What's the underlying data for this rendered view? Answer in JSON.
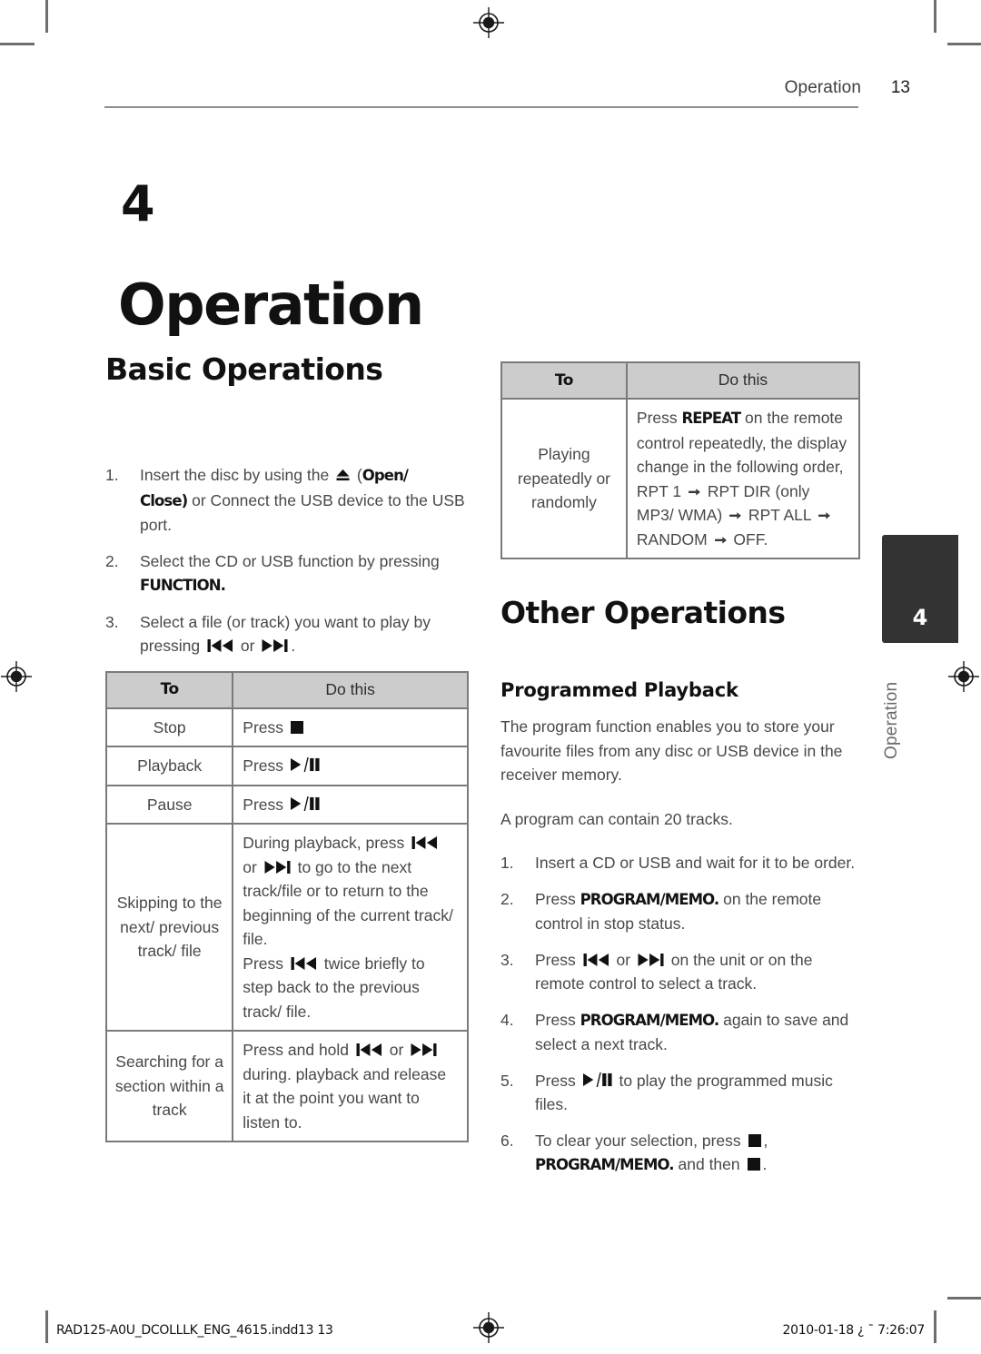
{
  "header": {
    "section_title": "Operation",
    "page_number": "13"
  },
  "chapter": {
    "number": "4",
    "title": "Operation"
  },
  "thumb_tab": {
    "number": "4",
    "label": "Operation"
  },
  "left_column": {
    "section_heading": "Basic Operations",
    "steps": [
      {
        "num": "1.",
        "parts": [
          {
            "t": "Insert the disc by using the "
          },
          {
            "icon": "eject-icon"
          },
          {
            "t": " ("
          },
          {
            "b": "Open/"
          },
          {
            "br": true
          },
          {
            "b": "Close)"
          },
          {
            "t": " or Connect the USB device to the USB port."
          }
        ]
      },
      {
        "num": "2.",
        "parts": [
          {
            "t": "Select the CD or USB function by pressing "
          },
          {
            "b": "FUNCTION."
          }
        ]
      },
      {
        "num": "3.",
        "parts": [
          {
            "t": "Select a file (or track) you want to play by pressing "
          },
          {
            "icon": "skip-previous-icon"
          },
          {
            "t": " or "
          },
          {
            "icon": "skip-next-icon"
          },
          {
            "t": "."
          }
        ]
      }
    ],
    "table": {
      "headers": [
        "To",
        "Do this"
      ],
      "rows": [
        {
          "to": "Stop",
          "do_parts": [
            {
              "t": "Press "
            },
            {
              "icon": "stop-icon"
            }
          ]
        },
        {
          "to": "Playback",
          "do_parts": [
            {
              "t": "Press "
            },
            {
              "icon": "play-pause-icon"
            }
          ]
        },
        {
          "to": "Pause",
          "do_parts": [
            {
              "t": "Press "
            },
            {
              "icon": "play-pause-icon"
            }
          ]
        },
        {
          "to": "Skipping to the next/ previous track/ file",
          "do_parts": [
            {
              "t": "During playback, press "
            },
            {
              "icon": "skip-previous-icon"
            },
            {
              "t": " or "
            },
            {
              "icon": "skip-next-icon"
            },
            {
              "t": " to go to the next track/file or to return to the beginning of the current track/ file."
            },
            {
              "br": true
            },
            {
              "t": "Press "
            },
            {
              "icon": "skip-previous-icon"
            },
            {
              "t": " twice briefly to step back to the previous track/ file."
            }
          ]
        },
        {
          "to": "Searching for a section within a track",
          "do_parts": [
            {
              "t": "Press and hold "
            },
            {
              "icon": "skip-previous-icon"
            },
            {
              "t": " or "
            },
            {
              "icon": "skip-next-icon"
            },
            {
              "t": " during. playback and release it at the point you want to listen to."
            }
          ]
        }
      ]
    }
  },
  "right_column": {
    "table": {
      "headers": [
        "To",
        "Do this"
      ],
      "rows": [
        {
          "to": "Playing repeatedly or randomly",
          "do_parts": [
            {
              "t": "Press "
            },
            {
              "b": "REPEAT"
            },
            {
              "t": " on the remote control repeatedly, the display change in the following order, RPT 1 "
            },
            {
              "icon": "arrow-right-icon"
            },
            {
              "t": " RPT DIR (only MP3/ WMA) "
            },
            {
              "icon": "arrow-right-icon"
            },
            {
              "t": " RPT ALL "
            },
            {
              "icon": "arrow-right-icon"
            },
            {
              "t": " RANDOM "
            },
            {
              "icon": "arrow-right-icon"
            },
            {
              "t": " OFF."
            }
          ]
        }
      ]
    },
    "section_heading": "Other Operations",
    "subsection_heading": "Programmed Playback",
    "intro_paragraph_1": "The program function enables you to store your favourite files from any disc or USB device in the receiver memory.",
    "intro_paragraph_2": "A program can contain 20 tracks.",
    "steps": [
      {
        "num": "1.",
        "parts": [
          {
            "t": "Insert a CD or USB and wait for it to be order."
          }
        ]
      },
      {
        "num": "2.",
        "parts": [
          {
            "t": "Press "
          },
          {
            "b": "PROGRAM/MEMO."
          },
          {
            "t": " on the remote control in stop status."
          }
        ]
      },
      {
        "num": "3.",
        "parts": [
          {
            "t": "Press "
          },
          {
            "icon": "skip-previous-icon"
          },
          {
            "t": " or "
          },
          {
            "icon": "skip-next-icon"
          },
          {
            "t": " on the unit or on the remote control to select a track."
          }
        ]
      },
      {
        "num": "4.",
        "parts": [
          {
            "t": "Press "
          },
          {
            "b": "PROGRAM/MEMO."
          },
          {
            "t": " again to save and select a next track."
          }
        ]
      },
      {
        "num": "5.",
        "parts": [
          {
            "t": "Press "
          },
          {
            "icon": "play-pause-icon"
          },
          {
            "t": " to play the programmed music files."
          }
        ]
      },
      {
        "num": "6.",
        "parts": [
          {
            "t": "To clear your selection, press "
          },
          {
            "icon": "stop-icon"
          },
          {
            "t": ", "
          },
          {
            "br": true
          },
          {
            "b": "PROGRAM/MEMO."
          },
          {
            "t": " and then "
          },
          {
            "icon": "stop-icon"
          },
          {
            "t": "."
          }
        ]
      }
    ]
  },
  "footer": {
    "file_name": "RAD125-A0U_DCOLLLK_ENG_4615.indd13   13",
    "timestamp": "2010-01-18   ¿ ¯ 7:26:07"
  },
  "colors": {
    "table_header_bg": "#cccccc",
    "table_border": "#7a7a7a",
    "thumb_tab_bg": "#333333",
    "body_text": "#484848",
    "heading_text": "#111111"
  }
}
